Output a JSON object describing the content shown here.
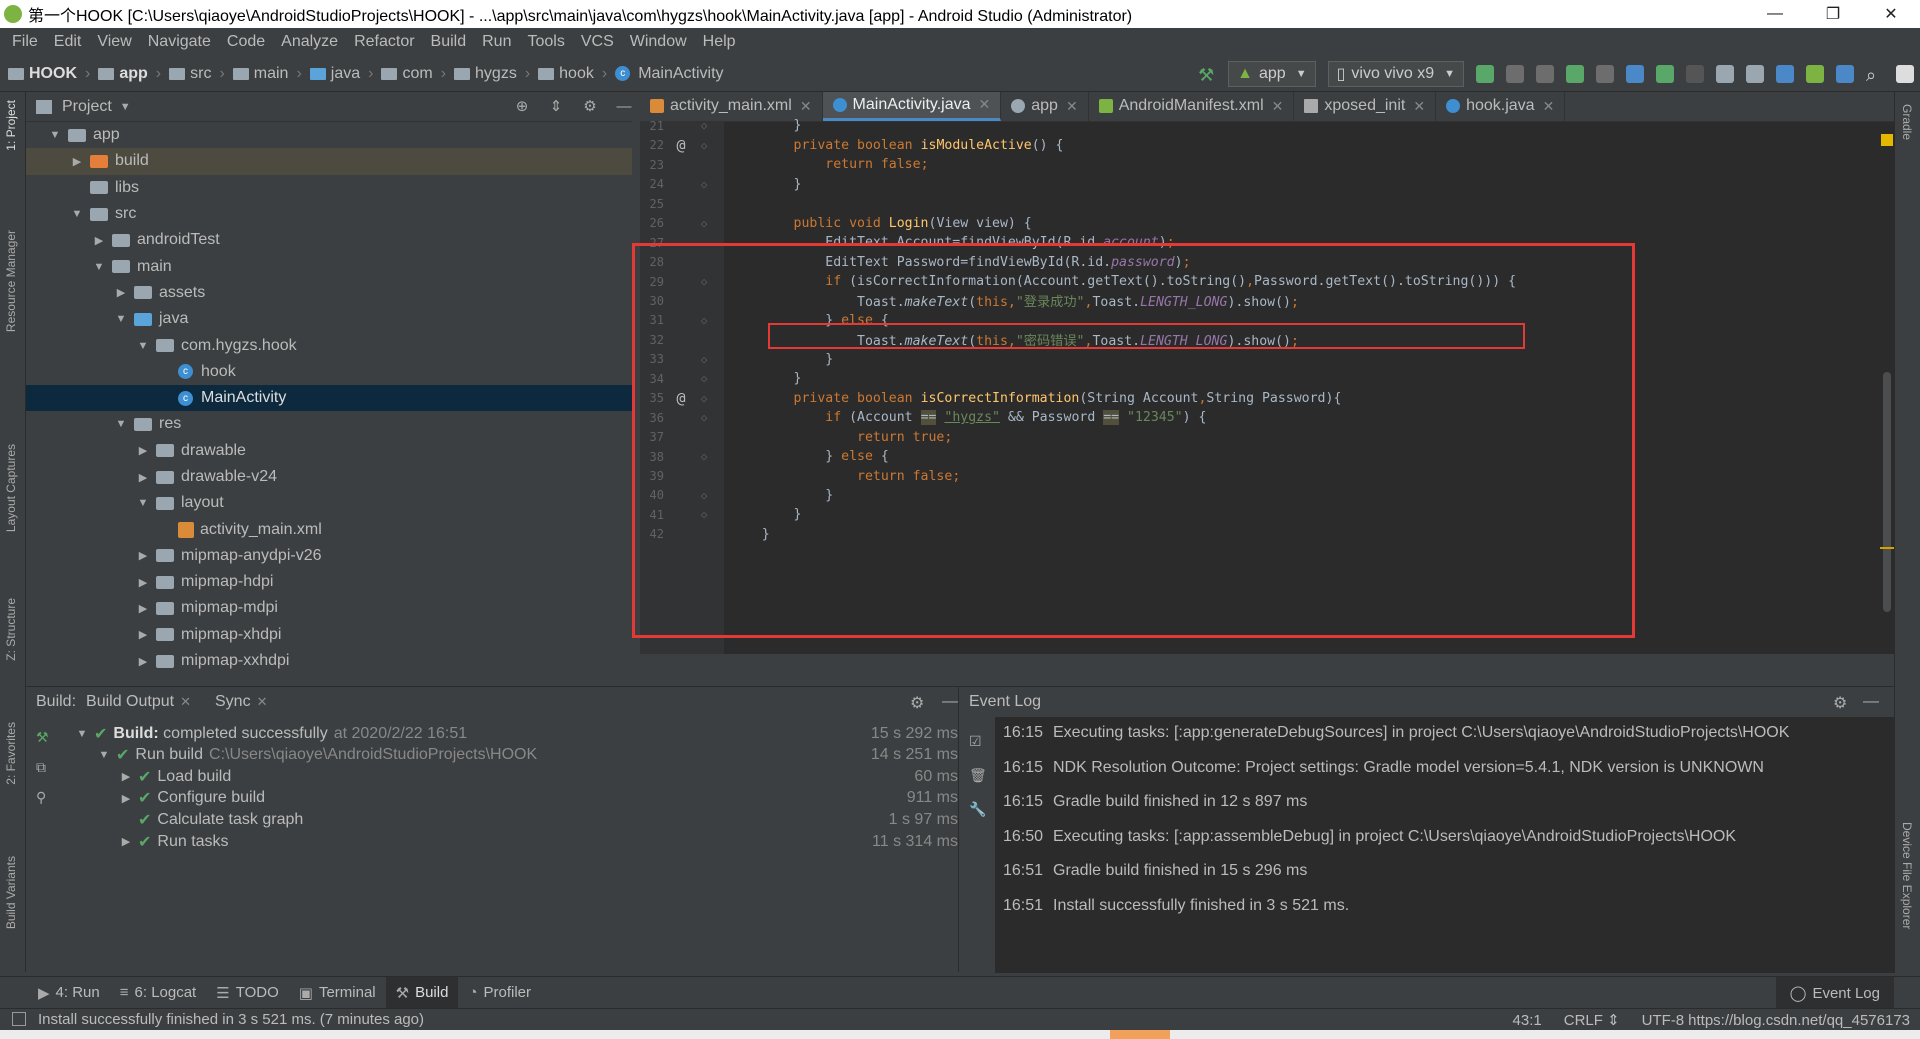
{
  "window": {
    "title": "第一个HOOK [C:\\Users\\qiaoye\\AndroidStudioProjects\\HOOK] - ...\\app\\src\\main\\java\\com\\hygzs\\hook\\MainActivity.java [app] - Android Studio (Administrator)",
    "minimize": "—",
    "maximize": "❐",
    "close": "✕"
  },
  "menu": [
    "File",
    "Edit",
    "View",
    "Navigate",
    "Code",
    "Analyze",
    "Refactor",
    "Build",
    "Run",
    "Tools",
    "VCS",
    "Window",
    "Help"
  ],
  "breadcrumb": [
    "HOOK",
    "app",
    "src",
    "main",
    "java",
    "com",
    "hygzs",
    "hook",
    "MainActivity"
  ],
  "toolbar": {
    "run_config": "app",
    "device": "vivo vivo x9"
  },
  "project_panel": {
    "title": "Project",
    "tree": [
      {
        "label": "app",
        "depth": 0,
        "arrow": "▼",
        "icon": "folder-gray"
      },
      {
        "label": "build",
        "depth": 1,
        "arrow": "▶",
        "icon": "folder-orange"
      },
      {
        "label": "libs",
        "depth": 1,
        "arrow": "",
        "icon": "folder-gray"
      },
      {
        "label": "src",
        "depth": 1,
        "arrow": "▼",
        "icon": "folder-gray"
      },
      {
        "label": "androidTest",
        "depth": 2,
        "arrow": "▶",
        "icon": "folder-gray"
      },
      {
        "label": "main",
        "depth": 2,
        "arrow": "▼",
        "icon": "folder-gray"
      },
      {
        "label": "assets",
        "depth": 3,
        "arrow": "▶",
        "icon": "folder-gray"
      },
      {
        "label": "java",
        "depth": 3,
        "arrow": "▼",
        "icon": "folder-blue"
      },
      {
        "label": "com.hygzs.hook",
        "depth": 4,
        "arrow": "▼",
        "icon": "folder-gray"
      },
      {
        "label": "hook",
        "depth": 5,
        "arrow": "",
        "icon": "class"
      },
      {
        "label": "MainActivity",
        "depth": 5,
        "arrow": "",
        "icon": "class"
      },
      {
        "label": "res",
        "depth": 3,
        "arrow": "▼",
        "icon": "folder-gray"
      },
      {
        "label": "drawable",
        "depth": 4,
        "arrow": "▶",
        "icon": "folder-gray"
      },
      {
        "label": "drawable-v24",
        "depth": 4,
        "arrow": "▶",
        "icon": "folder-gray"
      },
      {
        "label": "layout",
        "depth": 4,
        "arrow": "▼",
        "icon": "folder-gray"
      },
      {
        "label": "activity_main.xml",
        "depth": 5,
        "arrow": "",
        "icon": "xml"
      },
      {
        "label": "mipmap-anydpi-v26",
        "depth": 4,
        "arrow": "▶",
        "icon": "folder-gray"
      },
      {
        "label": "mipmap-hdpi",
        "depth": 4,
        "arrow": "▶",
        "icon": "folder-gray"
      },
      {
        "label": "mipmap-mdpi",
        "depth": 4,
        "arrow": "▶",
        "icon": "folder-gray"
      },
      {
        "label": "mipmap-xhdpi",
        "depth": 4,
        "arrow": "▶",
        "icon": "folder-gray"
      },
      {
        "label": "mipmap-xxhdpi",
        "depth": 4,
        "arrow": "▶",
        "icon": "folder-gray"
      }
    ]
  },
  "editor": {
    "tabs": [
      "activity_main.xml",
      "MainActivity.java",
      "app",
      "AndroidManifest.xml",
      "xposed_init",
      "hook.java"
    ],
    "lines": [
      {
        "n": "21",
        "a": "",
        "f": "◇",
        "parts": [
          [
            "",
            "        }"
          ]
        ]
      },
      {
        "n": "22",
        "a": "@",
        "f": "◇",
        "parts": [
          [
            "k",
            "        private boolean "
          ],
          [
            "fn",
            "isModuleActive"
          ],
          [
            "",
            "() {"
          ]
        ]
      },
      {
        "n": "23",
        "a": "",
        "f": "",
        "parts": [
          [
            "k",
            "            return false"
          ],
          [
            "k",
            ";"
          ]
        ]
      },
      {
        "n": "24",
        "a": "",
        "f": "◇",
        "parts": [
          [
            "",
            "        }"
          ]
        ]
      },
      {
        "n": "25",
        "a": "",
        "f": "",
        "parts": [
          [
            "",
            ""
          ]
        ]
      },
      {
        "n": "26",
        "a": "",
        "f": "◇",
        "parts": [
          [
            "k",
            "        public void "
          ],
          [
            "fn",
            "Login"
          ],
          [
            "",
            "(View view) {"
          ]
        ]
      },
      {
        "n": "27",
        "a": "",
        "f": "",
        "parts": [
          [
            "",
            "            EditText Account=findViewById(R.id."
          ],
          [
            "fi",
            "account"
          ],
          [
            "",
            ")"
          ],
          [
            "k",
            ";"
          ]
        ]
      },
      {
        "n": "28",
        "a": "",
        "f": "",
        "parts": [
          [
            "",
            "            EditText Password=findViewById(R.id."
          ],
          [
            "fi",
            "password"
          ],
          [
            "",
            ")"
          ],
          [
            "k",
            ";"
          ]
        ]
      },
      {
        "n": "29",
        "a": "",
        "f": "◇",
        "parts": [
          [
            "k",
            "            if "
          ],
          [
            "",
            "(isCorrectInformation(Account.getText().toString()"
          ],
          [
            "k",
            ","
          ],
          [
            "",
            "Password.getText().toString())) {"
          ]
        ]
      },
      {
        "n": "30",
        "a": "",
        "f": "",
        "parts": [
          [
            "",
            "                Toast."
          ],
          [
            "it",
            "makeText"
          ],
          [
            "",
            "("
          ],
          [
            "k",
            "this,"
          ],
          [
            "st",
            "\"登录成功\""
          ],
          [
            "k",
            ","
          ],
          [
            "",
            "Toast."
          ],
          [
            "fi",
            "LENGTH_LONG"
          ],
          [
            "",
            ").show()"
          ],
          [
            "k",
            ";"
          ]
        ]
      },
      {
        "n": "31",
        "a": "",
        "f": "◇",
        "parts": [
          [
            "",
            "            } "
          ],
          [
            "k",
            "else "
          ],
          [
            "",
            "{"
          ]
        ]
      },
      {
        "n": "32",
        "a": "",
        "f": "",
        "parts": [
          [
            "",
            "                Toast."
          ],
          [
            "it",
            "makeText"
          ],
          [
            "",
            "("
          ],
          [
            "k",
            "this,"
          ],
          [
            "st",
            "\"密码错误\""
          ],
          [
            "k",
            ","
          ],
          [
            "",
            "Toast."
          ],
          [
            "fi",
            "LENGTH_LONG"
          ],
          [
            "",
            ").show()"
          ],
          [
            "k",
            ";"
          ]
        ]
      },
      {
        "n": "33",
        "a": "",
        "f": "◇",
        "parts": [
          [
            "",
            "            }"
          ]
        ]
      },
      {
        "n": "34",
        "a": "",
        "f": "◇",
        "parts": [
          [
            "",
            "        }"
          ]
        ]
      },
      {
        "n": "35",
        "a": "@",
        "f": "◇",
        "parts": [
          [
            "k",
            "        private boolean "
          ],
          [
            "fn",
            "isCorrectInformation"
          ],
          [
            "",
            "(String Account"
          ],
          [
            "k",
            ","
          ],
          [
            "",
            "String Password){"
          ]
        ]
      },
      {
        "n": "36",
        "a": "",
        "f": "◇",
        "parts": [
          [
            "k",
            "            if "
          ],
          [
            "",
            "(Account "
          ],
          [
            "hl",
            "=="
          ],
          [
            "",
            " "
          ],
          [
            "stul",
            "\"hygzs\""
          ],
          [
            "",
            " && Password "
          ],
          [
            "hl",
            "=="
          ],
          [
            "",
            " "
          ],
          [
            "st",
            "\"12345\""
          ],
          [
            "",
            ") {"
          ]
        ]
      },
      {
        "n": "37",
        "a": "",
        "f": "",
        "parts": [
          [
            "k",
            "                return true"
          ],
          [
            "k",
            ";"
          ]
        ]
      },
      {
        "n": "38",
        "a": "",
        "f": "◇",
        "parts": [
          [
            "",
            "            } "
          ],
          [
            "k",
            "else "
          ],
          [
            "",
            "{"
          ]
        ]
      },
      {
        "n": "39",
        "a": "",
        "f": "",
        "parts": [
          [
            "k",
            "                return false"
          ],
          [
            "k",
            ";"
          ]
        ]
      },
      {
        "n": "40",
        "a": "",
        "f": "◇",
        "parts": [
          [
            "",
            "            }"
          ]
        ]
      },
      {
        "n": "41",
        "a": "",
        "f": "◇",
        "parts": [
          [
            "",
            "        }"
          ]
        ]
      },
      {
        "n": "42",
        "a": "",
        "f": "",
        "parts": [
          [
            "",
            "    }"
          ]
        ]
      }
    ]
  },
  "build_panel": {
    "label": "Build:",
    "tab_output": "Build Output",
    "tab_sync": "Sync",
    "rows": [
      {
        "indent": 0,
        "arrow": "▼",
        "check": true,
        "bold": "Build:",
        "text": " completed successfully",
        "muted": "at 2020/2/22 16:51",
        "time": "15 s 292 ms"
      },
      {
        "indent": 1,
        "arrow": "▼",
        "check": true,
        "bold": "",
        "text": "Run build",
        "muted": "C:\\Users\\qiaoye\\AndroidStudioProjects\\HOOK",
        "time": "14 s 251 ms"
      },
      {
        "indent": 2,
        "arrow": "▶",
        "check": true,
        "bold": "",
        "text": "Load build",
        "muted": "",
        "time": "60 ms"
      },
      {
        "indent": 2,
        "arrow": "▶",
        "check": true,
        "bold": "",
        "text": "Configure build",
        "muted": "",
        "time": "911 ms"
      },
      {
        "indent": 2,
        "arrow": "",
        "check": true,
        "bold": "",
        "text": "Calculate task graph",
        "muted": "",
        "time": "1 s 97 ms"
      },
      {
        "indent": 2,
        "arrow": "▶",
        "check": true,
        "bold": "",
        "text": "Run tasks",
        "muted": "",
        "time": "11 s 314 ms"
      }
    ]
  },
  "event_log": {
    "title": "Event Log",
    "entries": [
      {
        "time": "16:15",
        "msg": "Executing tasks: [:app:generateDebugSources] in project C:\\Users\\qiaoye\\AndroidStudioProjects\\HOOK"
      },
      {
        "time": "16:15",
        "msg": "NDK Resolution Outcome: Project settings: Gradle model version=5.4.1, NDK version is UNKNOWN"
      },
      {
        "time": "16:15",
        "msg": "Gradle build finished in 12 s 897 ms"
      },
      {
        "time": "16:50",
        "msg": "Executing tasks: [:app:assembleDebug] in project C:\\Users\\qiaoye\\AndroidStudioProjects\\HOOK"
      },
      {
        "time": "16:51",
        "msg": "Gradle build finished in 15 s 296 ms"
      },
      {
        "time": "16:51",
        "msg": "Install successfully finished in 3 s 521 ms."
      }
    ]
  },
  "tool_tabs": [
    {
      "icon": "▶",
      "label": "4: Run"
    },
    {
      "icon": "≡",
      "label": "6: Logcat"
    },
    {
      "icon": "☰",
      "label": "TODO"
    },
    {
      "icon": "▣",
      "label": "Terminal"
    },
    {
      "icon": "⚒",
      "label": "Build"
    },
    {
      "icon": "◔",
      "label": "Profiler"
    }
  ],
  "event_log_tab": "Event Log",
  "left_stripe": [
    "1: Project",
    "Resource Manager",
    "Layout Captures",
    "Z: Structure",
    "2: Favorites",
    "Build Variants"
  ],
  "right_stripe": [
    "Gradle",
    "Device File Explorer"
  ],
  "status": {
    "message": "Install successfully finished in 3 s 521 ms. (7 minutes ago)",
    "position": "43:1",
    "line_sep": "CRLF ⇕",
    "encoding": "UTF-8",
    "watermark": "https://blog.csdn.net/qq_4576173"
  },
  "colors": {
    "keyword": "#cc7832",
    "method": "#ffc66d",
    "string": "#6a8759",
    "field": "#9876aa",
    "highlight_box": "#e53935"
  }
}
